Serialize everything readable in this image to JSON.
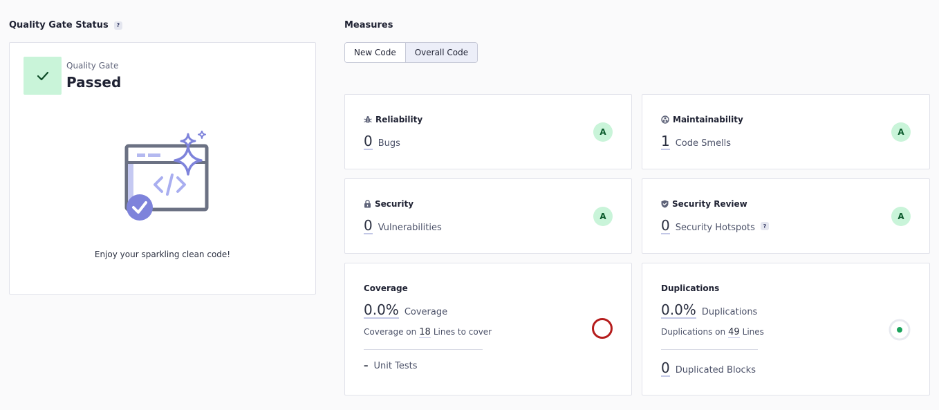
{
  "quality_gate": {
    "section_title": "Quality Gate Status",
    "help": "?",
    "label": "Quality Gate",
    "status": "Passed",
    "message": "Enjoy your sparkling clean code!"
  },
  "measures": {
    "section_title": "Measures",
    "tabs": [
      {
        "label": "New Code",
        "active": false
      },
      {
        "label": "Overall Code",
        "active": true
      }
    ],
    "reliability": {
      "title": "Reliability",
      "value": "0",
      "unit": "Bugs",
      "rating": "A"
    },
    "maintainability": {
      "title": "Maintainability",
      "value": "1",
      "unit": "Code Smells",
      "rating": "A"
    },
    "security": {
      "title": "Security",
      "value": "0",
      "unit": "Vulnerabilities",
      "rating": "A"
    },
    "security_review": {
      "title": "Security Review",
      "value": "0",
      "unit": "Security Hotspots",
      "help": "?",
      "rating": "A"
    },
    "coverage": {
      "title": "Coverage",
      "value": "0.0%",
      "unit": "Coverage",
      "sub_prefix": "Coverage on",
      "sub_count": "18",
      "sub_suffix": "Lines to cover",
      "unit_tests_value": "–",
      "unit_tests_label": "Unit Tests",
      "ring_color": "#b51c1c"
    },
    "duplications": {
      "title": "Duplications",
      "value": "0.0%",
      "unit": "Duplications",
      "sub_prefix": "Duplications on",
      "sub_count": "49",
      "sub_suffix": "Lines",
      "blocks_value": "0",
      "blocks_label": "Duplicated Blocks",
      "dot_color": "#1ba35c"
    }
  },
  "colors": {
    "rating_bg": "#c9f4d9",
    "rating_text": "#0b5a2c",
    "accent": "#7e83db"
  }
}
